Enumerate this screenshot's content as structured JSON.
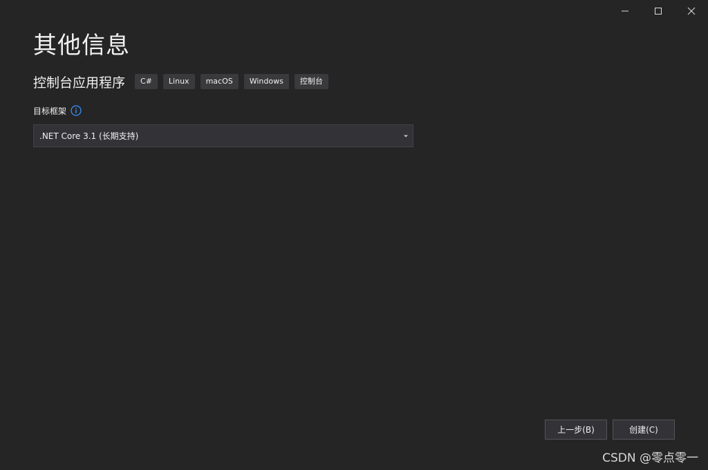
{
  "page": {
    "title": "其他信息"
  },
  "template": {
    "name": "控制台应用程序",
    "tags": [
      "C#",
      "Linux",
      "macOS",
      "Windows",
      "控制台"
    ]
  },
  "framework": {
    "label": "目标框架",
    "info_icon": "info-icon",
    "selected": ".NET Core 3.1 (长期支持)"
  },
  "buttons": {
    "back": "上一步(B)",
    "create": "创建(C)"
  },
  "window_controls": [
    "minimize-icon",
    "maximize-icon",
    "close-icon"
  ],
  "watermark": "CSDN @零点零一",
  "colors": {
    "background": "#252526",
    "text": "#f1f1f1",
    "tag_bg": "#3a3a3c",
    "input_bg": "#333337",
    "info_accent": "#3794ff"
  }
}
